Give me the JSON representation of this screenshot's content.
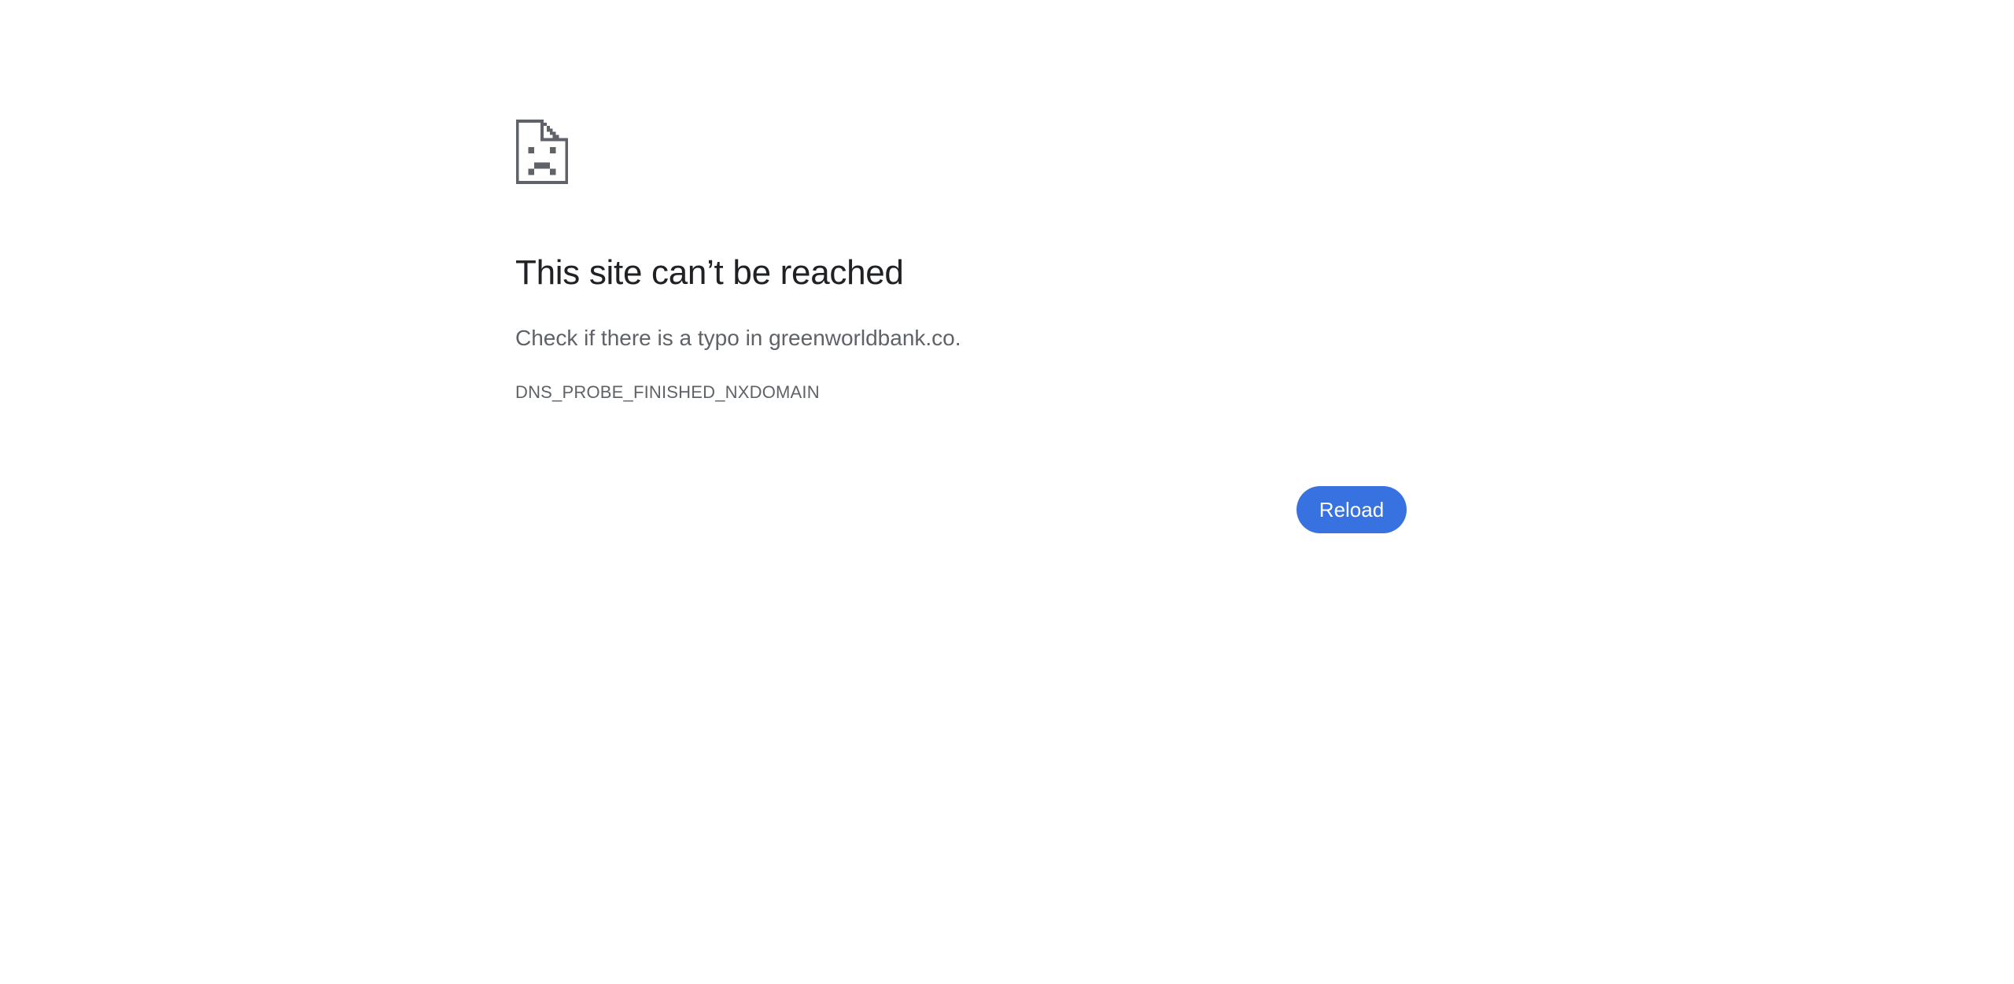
{
  "error": {
    "icon": "sad-document-icon",
    "title": "This site can’t be reached",
    "message": "Check if there is a typo in greenworldbank.co.",
    "code": "DNS_PROBE_FINISHED_NXDOMAIN"
  },
  "actions": {
    "reload_label": "Reload"
  },
  "colors": {
    "background": "#ffffff",
    "title": "#202124",
    "secondary_text": "#5f6368",
    "icon": "#5f6368",
    "button": "#3872e0",
    "button_text": "#ffffff"
  }
}
